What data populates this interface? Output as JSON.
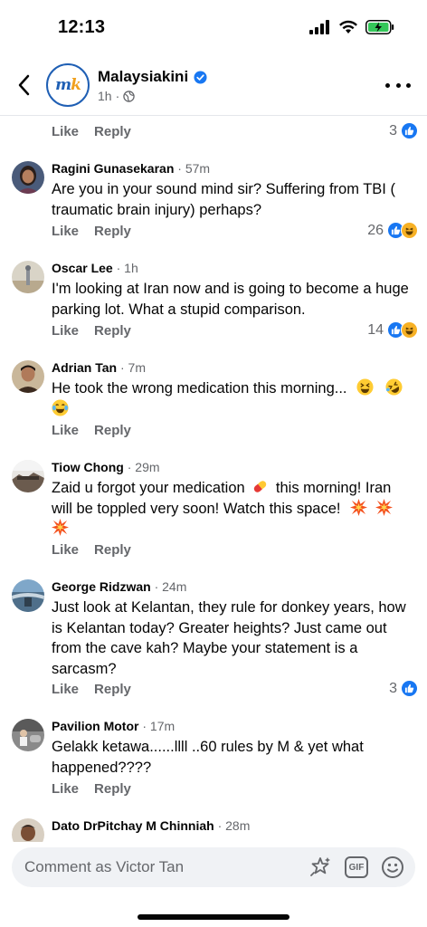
{
  "status_bar": {
    "time": "12:13",
    "battery_color": "#34c759"
  },
  "header": {
    "page_name": "Malaysiakini",
    "avatar_text_left": "m",
    "avatar_text_right": "k",
    "post_time": "1h",
    "verified_color": "#1877f2"
  },
  "actions": {
    "like": "Like",
    "reply": "Reply"
  },
  "top_reaction_count": "3",
  "comments": [
    {
      "name": "Ragini Gunasekaran",
      "time": "57m",
      "text": "Are you in your sound mind sir? Suffering from TBI ( traumatic brain injury) perhaps?",
      "reactions": "26",
      "reaction_icons": [
        "like-icon",
        "haha-icon"
      ]
    },
    {
      "name": "Oscar Lee",
      "time": "1h",
      "text": "I'm looking at Iran now and is going to become a huge parking lot. What a stupid comparison.",
      "reactions": "14",
      "reaction_icons": [
        "like-icon",
        "haha-icon"
      ]
    },
    {
      "name": "Adrian Tan",
      "time": "7m",
      "text": "He took the wrong medication this morning...",
      "emojis": [
        "laughing-face-emoji",
        "rofl-emoji",
        "tears-of-joy-emoji"
      ]
    },
    {
      "name": "Tiow Chong",
      "time": "29m",
      "text_part1": "Zaid u forgot your medication",
      "text_part2": "this morning! Iran will be toppled very soon! Watch this space!",
      "emojis": [
        "pill-emoji",
        "collision-emoji",
        "collision-emoji",
        "collision-emoji"
      ]
    },
    {
      "name": "George Ridzwan",
      "time": "24m",
      "text": "Just look at Kelantan, they rule for donkey years, how is Kelantan today? Greater heights? Just came out from the cave kah? Maybe your statement is a sarcasm?",
      "reactions": "3",
      "reaction_icons": [
        "like-icon"
      ]
    },
    {
      "name": "Pavilion Motor",
      "time": "17m",
      "text": "Gelakk ketawa......llll ..60 rules by M & yet what happened????"
    },
    {
      "name": "Dato DrPitchay M Chinniah",
      "time": "28m",
      "text": ""
    }
  ],
  "footer": {
    "comment_placeholder": "Comment as Victor Tan",
    "gif_label": "GIF"
  },
  "colors": {
    "accent": "#1877f2",
    "secondary_text": "#65676b",
    "haha": "#f7b125"
  }
}
